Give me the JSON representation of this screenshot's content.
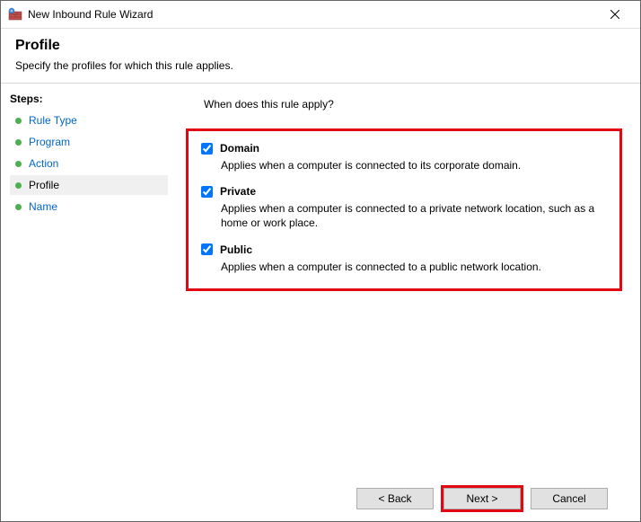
{
  "window": {
    "title": "New Inbound Rule Wizard"
  },
  "header": {
    "title": "Profile",
    "subtitle": "Specify the profiles for which this rule applies."
  },
  "sidebar": {
    "label": "Steps:",
    "items": [
      {
        "label": "Rule Type"
      },
      {
        "label": "Program"
      },
      {
        "label": "Action"
      },
      {
        "label": "Profile"
      },
      {
        "label": "Name"
      }
    ],
    "current_index": 3
  },
  "content": {
    "question": "When does this rule apply?",
    "options": [
      {
        "key": "domain",
        "label": "Domain",
        "desc": "Applies when a computer is connected to its corporate domain.",
        "checked": true
      },
      {
        "key": "private",
        "label": "Private",
        "desc": "Applies when a computer is connected to a private network location, such as a home or work place.",
        "checked": true
      },
      {
        "key": "public",
        "label": "Public",
        "desc": "Applies when a computer is connected to a public network location.",
        "checked": true
      }
    ]
  },
  "footer": {
    "back": "< Back",
    "next": "Next >",
    "cancel": "Cancel"
  }
}
